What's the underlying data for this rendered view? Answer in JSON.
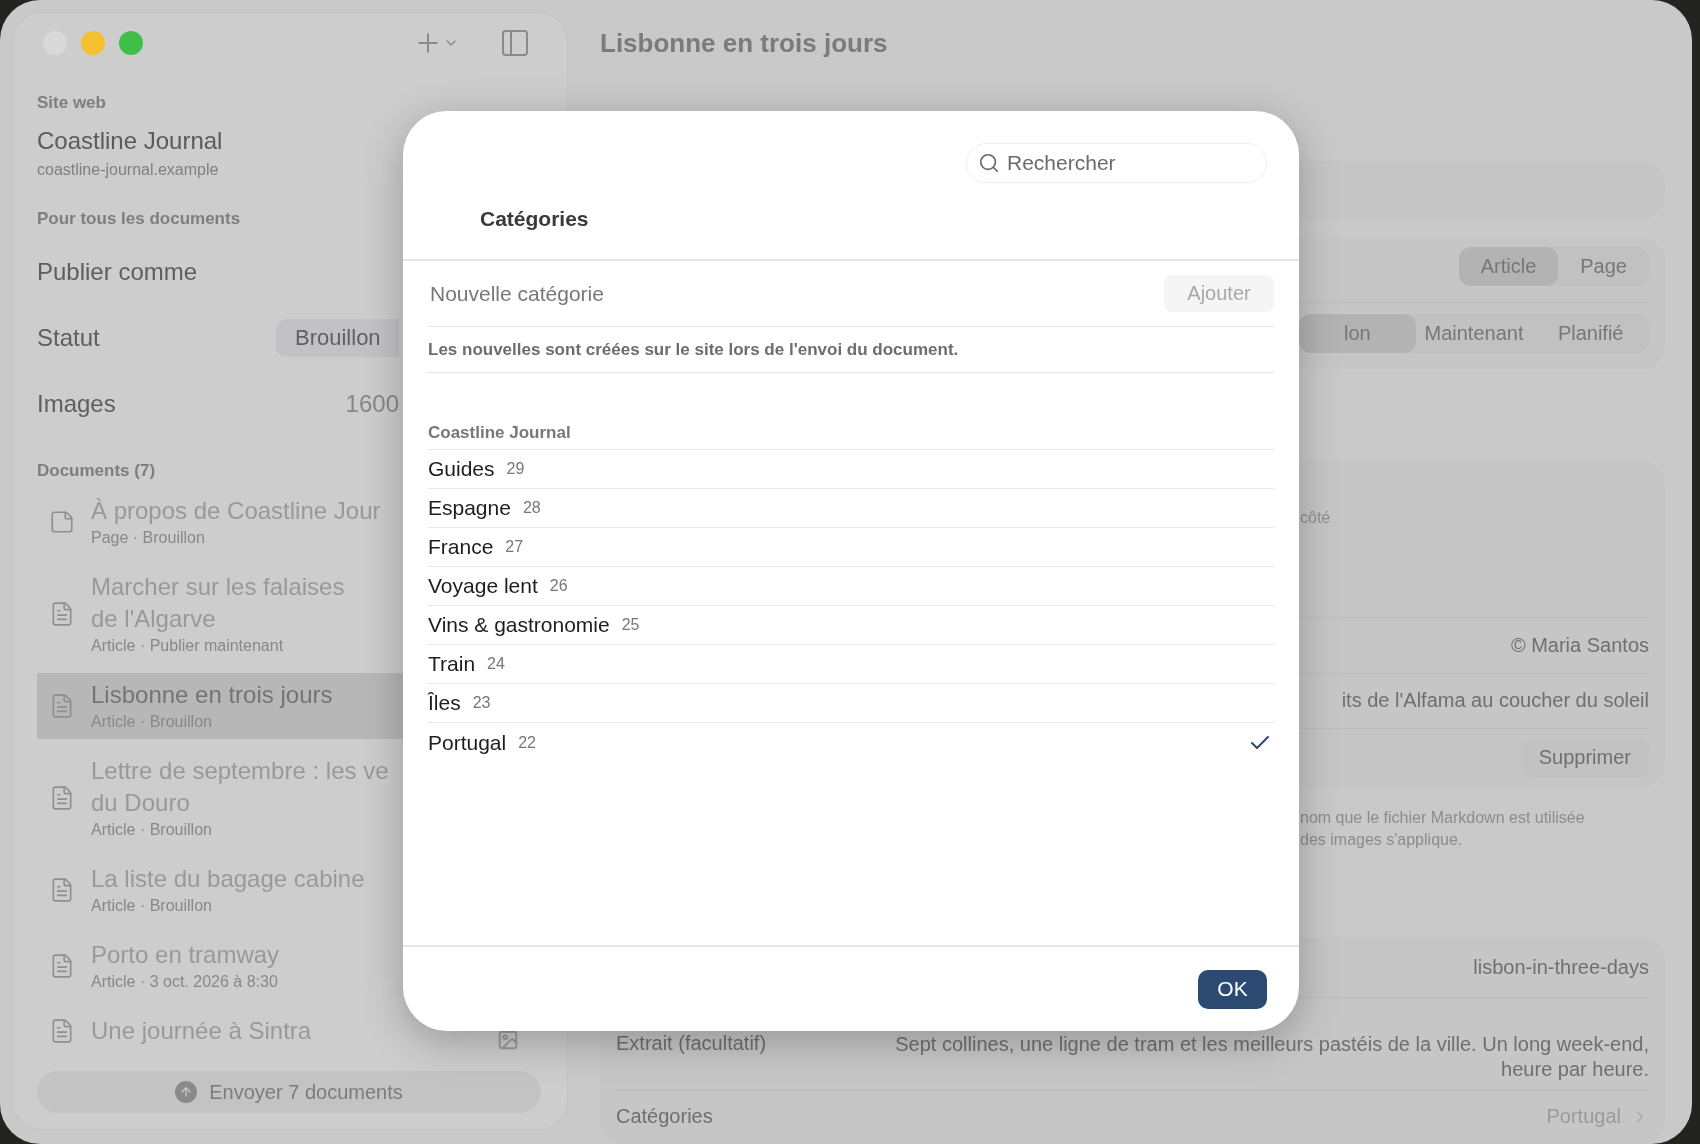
{
  "window_controls": [
    {
      "kind": "close",
      "disabled": true
    },
    {
      "kind": "minimize",
      "disabled": false
    },
    {
      "kind": "zoom",
      "disabled": false
    }
  ],
  "sidebar": {
    "site_label": "Site web",
    "site_name": "Coastline Journal",
    "site_url": "coastline-journal.example",
    "section_label": "Pour tous les documents",
    "settings": [
      {
        "kind": "heading",
        "label": "Publier comme"
      },
      {
        "kind": "button",
        "label": "Statut",
        "value": "Brouillon"
      },
      {
        "kind": "value",
        "label": "Images",
        "value": "1600"
      }
    ],
    "documents_label": "Documents (7)",
    "documents": [
      {
        "kind": "page",
        "title_lines": [
          "À propos de Coastline Jour"
        ],
        "subtitle": "Page · Brouillon",
        "selected": false
      },
      {
        "kind": "article",
        "title_lines": [
          "Marcher sur les falaises",
          "de l'Algarve"
        ],
        "subtitle": "Article · Publier maintenant",
        "selected": false
      },
      {
        "kind": "article",
        "title_lines": [
          "Lisbonne en trois jours"
        ],
        "subtitle": "Article · Brouillon",
        "selected": true
      },
      {
        "kind": "article",
        "title_lines": [
          "Lettre de septembre : les ve",
          "du Douro"
        ],
        "subtitle": "Article · Brouillon",
        "selected": false
      },
      {
        "kind": "article",
        "title_lines": [
          "La liste du bagage cabine"
        ],
        "subtitle": "Article · Brouillon",
        "selected": false
      },
      {
        "kind": "article",
        "title_lines": [
          "Porto en tramway"
        ],
        "subtitle": "Article · 3 oct. 2026 à 8:30",
        "selected": false
      },
      {
        "kind": "article",
        "title_lines": [
          "Une journée à Sintra"
        ],
        "has_image": true,
        "selected": false
      }
    ],
    "send_button": "Envoyer 7 documents"
  },
  "main": {
    "title": "Lisbonne en trois jours",
    "type_segments": [
      {
        "label": "Article",
        "selected": true
      },
      {
        "label": "Page",
        "selected": false
      }
    ],
    "status_segments": [
      {
        "label": "lon",
        "selected": true
      },
      {
        "label": "Maintenant",
        "selected": false
      },
      {
        "label": "Planifié",
        "selected": false
      }
    ],
    "image_hint": "côté",
    "credit": "© Maria Santos",
    "caption": "its de l'Alfama au coucher du soleil",
    "delete_button": "Supprimer",
    "note_lines": [
      "nom que le fichier Markdown est utilisée",
      "des images s'applique."
    ],
    "slug": "lisbon-in-three-days",
    "excerpt_label": "Extrait (facultatif)",
    "excerpt": "Sept collines, une ligne de tram et les meilleurs pastéis de la ville. Un long week-end, heure par heure.",
    "categories_label": "Catégories",
    "categories_value": "Portugal"
  },
  "dialog": {
    "search": {
      "placeholder": "Rechercher"
    },
    "title": "Catégories",
    "new_category": {
      "placeholder": "Nouvelle catégorie"
    },
    "add_button": {
      "label": "Ajouter",
      "disabled": true
    },
    "hint": "Les nouvelles sont créées sur le site lors de l'envoi du document.",
    "group": "Coastline Journal",
    "categories": [
      {
        "name": "Guides",
        "count": "29",
        "selected": false
      },
      {
        "name": "Espagne",
        "count": "28",
        "selected": false
      },
      {
        "name": "France",
        "count": "27",
        "selected": false
      },
      {
        "name": "Voyage lent",
        "count": "26",
        "selected": false
      },
      {
        "name": "Vins & gastronomie",
        "count": "25",
        "selected": false
      },
      {
        "name": "Train",
        "count": "24",
        "selected": false
      },
      {
        "name": "Îles",
        "count": "23",
        "selected": false
      },
      {
        "name": "Portugal",
        "count": "22",
        "selected": true
      }
    ],
    "ok_button": "OK"
  }
}
